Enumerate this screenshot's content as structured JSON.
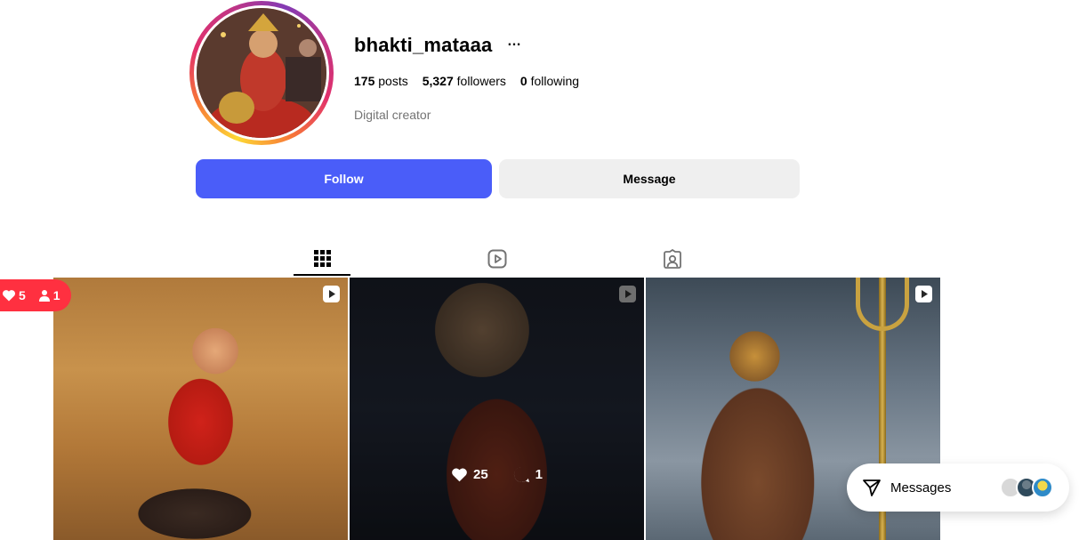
{
  "profile": {
    "username": "bhakti_mataaa",
    "more_icon": "…",
    "stats": {
      "posts_count": "175",
      "posts_label": "posts",
      "followers_count": "5,327",
      "followers_label": "followers",
      "following_count": "0",
      "following_label": "following"
    },
    "category": "Digital creator"
  },
  "actions": {
    "follow_label": "Follow",
    "message_label": "Message"
  },
  "tabs": [
    {
      "icon": "grid-icon",
      "active": true
    },
    {
      "icon": "reels-icon",
      "active": false
    },
    {
      "icon": "tagged-icon",
      "active": false
    }
  ],
  "posts": [
    {
      "type": "reel",
      "icon": "reel-icon"
    },
    {
      "type": "reel",
      "icon": "reel-icon",
      "likes": "25",
      "comments": "1"
    },
    {
      "type": "reel",
      "icon": "reel-icon"
    }
  ],
  "notification": {
    "likes": "5",
    "followers": "1"
  },
  "messages": {
    "label": "Messages"
  },
  "colors": {
    "follow_button": "#4a5df9",
    "message_button": "#efefef",
    "notification": "#ff3040"
  }
}
